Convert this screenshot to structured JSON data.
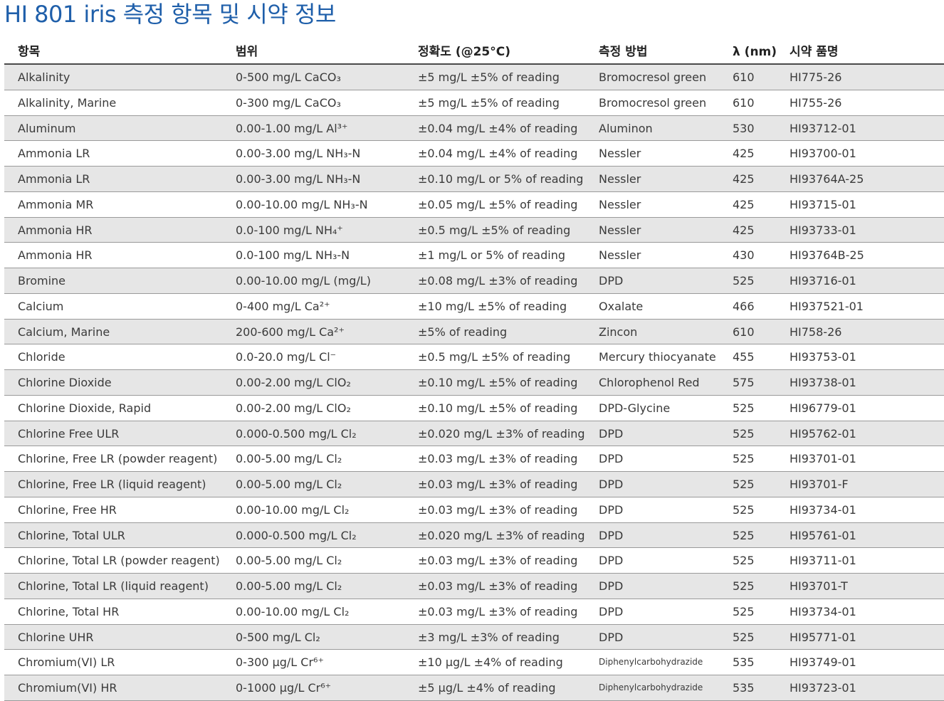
{
  "title": "HI 801 iris 측정 항목 및 시약 정보",
  "columns": [
    "항목",
    "범위",
    "정확도 (@25°C)",
    "측정 방법",
    "λ (nm)",
    "시약 품명"
  ],
  "rows": [
    {
      "item": "Alkalinity",
      "range": "0-500 mg/L CaCO₃",
      "accuracy": "±5 mg/L  ±5% of reading",
      "method": "Bromocresol green",
      "wavelength": "610",
      "reagent": "HI775-26"
    },
    {
      "item": "Alkalinity, Marine",
      "range": "0-300 mg/L CaCO₃",
      "accuracy": "±5 mg/L ±5% of reading",
      "method": "Bromocresol green",
      "wavelength": "610",
      "reagent": "HI755-26"
    },
    {
      "item": "Aluminum",
      "range": "0.00-1.00 mg/L Al³⁺",
      "accuracy": "±0.04 mg/L ±4% of reading",
      "method": "Aluminon",
      "wavelength": "530",
      "reagent": "HI93712-01"
    },
    {
      "item": "Ammonia LR",
      "range": "0.00-3.00 mg/L NH₃-N",
      "accuracy": "±0.04 mg/L ±4% of reading",
      "method": "Nessler",
      "wavelength": "425",
      "reagent": "HI93700-01"
    },
    {
      "item": "Ammonia LR",
      "range": "0.00-3.00 mg/L NH₃-N",
      "accuracy": "±0.10 mg/L or 5% of reading",
      "method": "Nessler",
      "wavelength": "425",
      "reagent": "HI93764A-25"
    },
    {
      "item": "Ammonia MR",
      "range": "0.00-10.00 mg/L NH₃-N",
      "accuracy": "±0.05 mg/L ±5% of reading",
      "method": "Nessler",
      "wavelength": "425",
      "reagent": "HI93715-01"
    },
    {
      "item": "Ammonia HR",
      "range": "0.0-100 mg/L NH₄⁺",
      "accuracy": "±0.5 mg/L ±5% of reading",
      "method": "Nessler",
      "wavelength": "425",
      "reagent": "HI93733-01"
    },
    {
      "item": "Ammonia HR",
      "range": "0.0-100 mg/L NH₃-N",
      "accuracy": "±1 mg/L or 5% of reading",
      "method": "Nessler",
      "wavelength": "430",
      "reagent": "HI93764B-25"
    },
    {
      "item": "Bromine",
      "range": "0.00-10.00 mg/L (mg/L)",
      "accuracy": "±0.08 mg/L ±3% of reading",
      "method": "DPD",
      "wavelength": "525",
      "reagent": "HI93716-01"
    },
    {
      "item": "Calcium",
      "range": "0-400 mg/L Ca²⁺",
      "accuracy": "±10 mg/L ±5% of reading",
      "method": "Oxalate",
      "wavelength": "466",
      "reagent": "HI937521-01"
    },
    {
      "item": "Calcium, Marine",
      "range": "200-600 mg/L Ca²⁺",
      "accuracy": "±5% of reading",
      "method": "Zincon",
      "wavelength": "610",
      "reagent": "HI758-26"
    },
    {
      "item": "Chloride",
      "range": "0.0-20.0 mg/L Cl⁻",
      "accuracy": "±0.5 mg/L ±5% of reading",
      "method": "Mercury thiocyanate",
      "wavelength": "455",
      "reagent": "HI93753-01"
    },
    {
      "item": "Chlorine Dioxide",
      "range": "0.00-2.00 mg/L ClO₂",
      "accuracy": "±0.10 mg/L ±5% of reading",
      "method": "Chlorophenol Red",
      "wavelength": "575",
      "reagent": "HI93738-01"
    },
    {
      "item": "Chlorine Dioxide, Rapid",
      "range": "0.00-2.00 mg/L ClO₂",
      "accuracy": "±0.10 mg/L ±5% of reading",
      "method": "DPD-Glycine",
      "wavelength": "525",
      "reagent": "HI96779-01"
    },
    {
      "item": "Chlorine Free ULR",
      "range": "0.000-0.500 mg/L Cl₂",
      "accuracy": "±0.020 mg/L ±3% of reading",
      "method": "DPD",
      "wavelength": "525",
      "reagent": "HI95762-01"
    },
    {
      "item": "Chlorine, Free LR (powder reagent)",
      "range": "0.00-5.00 mg/L Cl₂",
      "accuracy": "±0.03 mg/L ±3% of reading",
      "method": "DPD",
      "wavelength": "525",
      "reagent": "HI93701-01"
    },
    {
      "item": "Chlorine, Free LR (liquid reagent)",
      "range": "0.00-5.00 mg/L Cl₂",
      "accuracy": "±0.03 mg/L ±3% of reading",
      "method": "DPD",
      "wavelength": "525",
      "reagent": "HI93701-F"
    },
    {
      "item": "Chlorine, Free HR",
      "range": "0.00-10.00 mg/L Cl₂",
      "accuracy": "±0.03 mg/L ±3% of reading",
      "method": "DPD",
      "wavelength": "525",
      "reagent": "HI93734-01"
    },
    {
      "item": "Chlorine, Total ULR",
      "range": "0.000-0.500 mg/L Cl₂",
      "accuracy": "±0.020 mg/L ±3% of reading",
      "method": "DPD",
      "wavelength": "525",
      "reagent": "HI95761-01"
    },
    {
      "item": "Chlorine, Total LR (powder reagent)",
      "range": "0.00-5.00 mg/L Cl₂",
      "accuracy": "±0.03 mg/L ±3% of reading",
      "method": "DPD",
      "wavelength": "525",
      "reagent": "HI93711-01"
    },
    {
      "item": "Chlorine, Total LR (liquid reagent)",
      "range": "0.00-5.00 mg/L Cl₂",
      "accuracy": "±0.03 mg/L ±3% of reading",
      "method": "DPD",
      "wavelength": "525",
      "reagent": "HI93701-T"
    },
    {
      "item": "Chlorine, Total HR",
      "range": "0.00-10.00 mg/L Cl₂",
      "accuracy": "±0.03 mg/L ±3% of reading",
      "method": "DPD",
      "wavelength": "525",
      "reagent": "HI93734-01"
    },
    {
      "item": "Chlorine UHR",
      "range": "0-500 mg/L Cl₂",
      "accuracy": "±3 mg/L ±3% of reading",
      "method": "DPD",
      "wavelength": "525",
      "reagent": "HI95771-01"
    },
    {
      "item": "Chromium(VI) LR",
      "range": "0-300 μg/L Cr⁶⁺",
      "accuracy": "±10 μg/L ±4% of reading",
      "method": "Diphenylcarbohydrazide",
      "wavelength": "535",
      "reagent": "HI93749-01"
    },
    {
      "item": "Chromium(VI) HR",
      "range": "0-1000 μg/L Cr⁶⁺",
      "accuracy": "±5 μg/L ±4% of reading",
      "method": "Diphenylcarbohydrazide",
      "wavelength": "535",
      "reagent": "HI93723-01"
    }
  ]
}
